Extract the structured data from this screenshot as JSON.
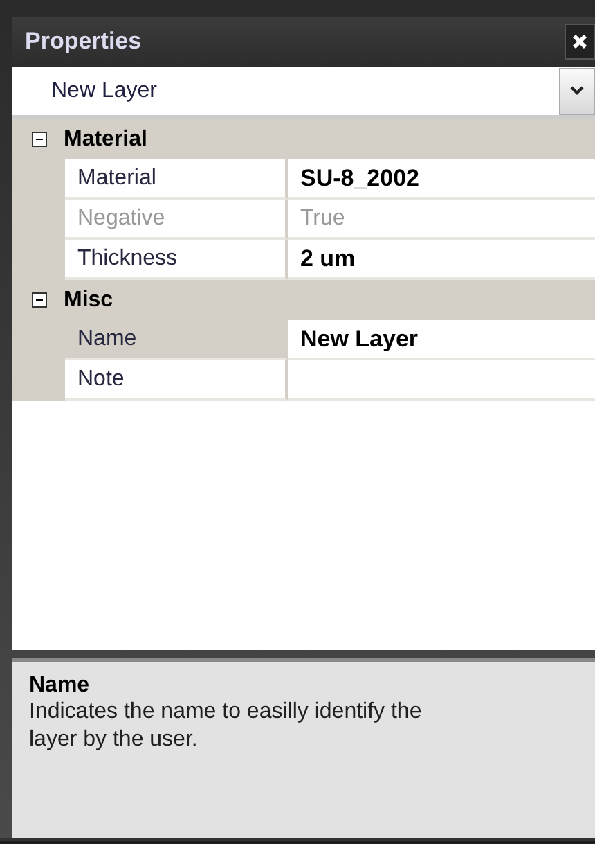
{
  "panel": {
    "title": "Properties"
  },
  "object_selector": {
    "value": "New Layer"
  },
  "categories": [
    {
      "name": "Material",
      "expanded": true,
      "properties": [
        {
          "name": "Material",
          "value": "SU-8_2002",
          "modified": true,
          "disabled": false,
          "selected": false
        },
        {
          "name": "Negative",
          "value": "True",
          "modified": false,
          "disabled": true,
          "selected": false
        },
        {
          "name": "Thickness",
          "value": "2 um",
          "modified": true,
          "disabled": false,
          "selected": false
        }
      ]
    },
    {
      "name": "Misc",
      "expanded": true,
      "properties": [
        {
          "name": "Name",
          "value": "New Layer",
          "modified": true,
          "disabled": false,
          "selected": true
        },
        {
          "name": "Note",
          "modified": false,
          "disabled": false,
          "selected": false
        }
      ]
    }
  ],
  "description": {
    "title": "Name",
    "text": "Indicates the name to easilly identify the layer by the user."
  }
}
